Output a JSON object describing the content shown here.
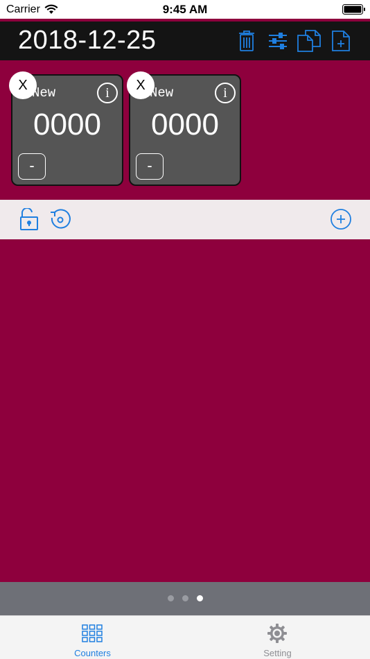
{
  "status_bar": {
    "carrier": "Carrier",
    "time": "9:45 AM"
  },
  "header": {
    "date": "2018-12-25",
    "actions": [
      "trash-icon",
      "sliders-icon",
      "copy-icon",
      "new-document-icon"
    ]
  },
  "counters": [
    {
      "name": "New",
      "value": "0000",
      "delete_label": "X",
      "info_label": "i",
      "decrement_label": "-"
    },
    {
      "name": "New",
      "value": "0000",
      "delete_label": "X",
      "info_label": "i",
      "decrement_label": "-"
    }
  ],
  "toolbar": {
    "left_icons": [
      "unlock-icon",
      "reset-icon"
    ],
    "right_icons": [
      "add-circle-icon"
    ]
  },
  "page_control": {
    "pages": 3,
    "current": 3
  },
  "tabbar": {
    "tabs": [
      {
        "label": "Counters",
        "icon": "grid-icon",
        "selected": true
      },
      {
        "label": "Setting",
        "icon": "gear-icon",
        "selected": false
      }
    ]
  },
  "colors": {
    "background": "#8e003d",
    "header": "#141414",
    "accent": "#1f7fe0",
    "card": "#555555",
    "toolbar": "#f0eaec",
    "page_control": "#6e7077",
    "tab_inactive": "#8e8e93"
  }
}
